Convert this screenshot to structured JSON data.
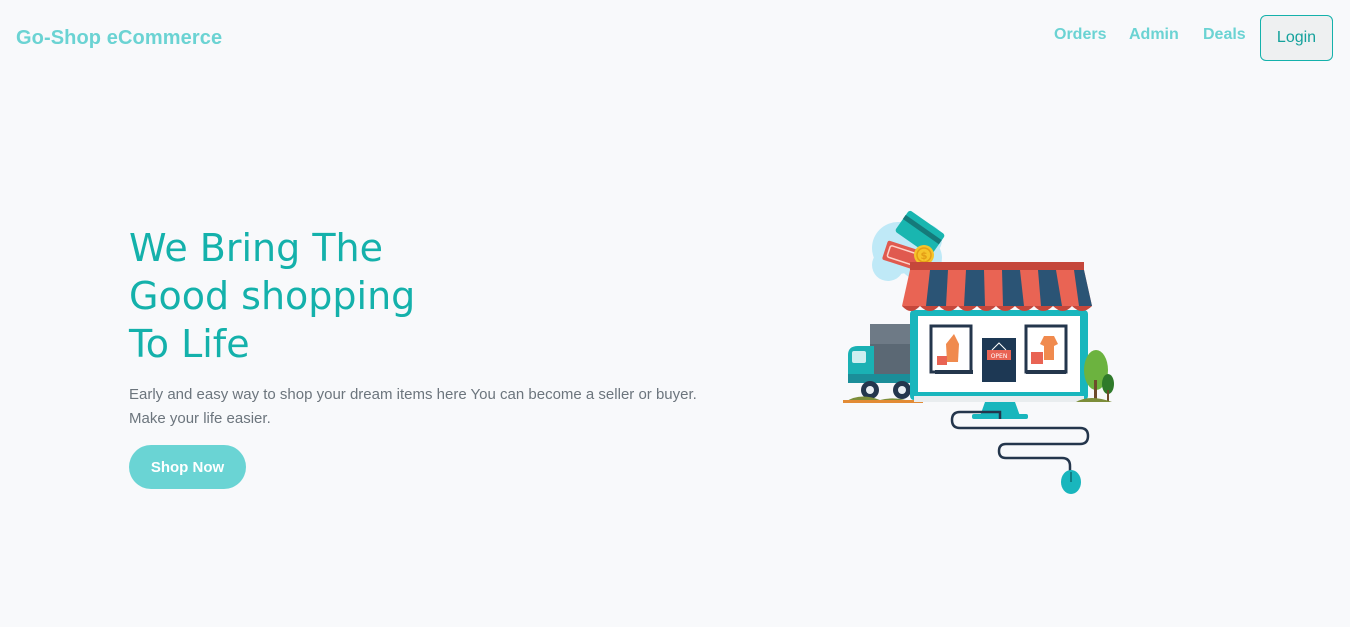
{
  "navbar": {
    "brand": "Go-Shop eCommerce",
    "links": [
      "Orders",
      "Admin",
      "Deals"
    ],
    "login_label": "Login"
  },
  "hero": {
    "title_lines": [
      "We Bring The",
      "Good shopping",
      "To Life"
    ],
    "description": "Early and easy way to shop your dream items here You can become a seller or buyer. Make your life easier.",
    "cta_label": "Shop Now",
    "sign_text": "OPEN"
  },
  "colors": {
    "brand": "#6bd3d3",
    "accent": "#14b1ab",
    "cta_background": "#6ad4d4",
    "page_background": "#f8f9fb",
    "text_muted": "#6c757d"
  },
  "illustration": {
    "icon": "online-shop-illustration"
  }
}
